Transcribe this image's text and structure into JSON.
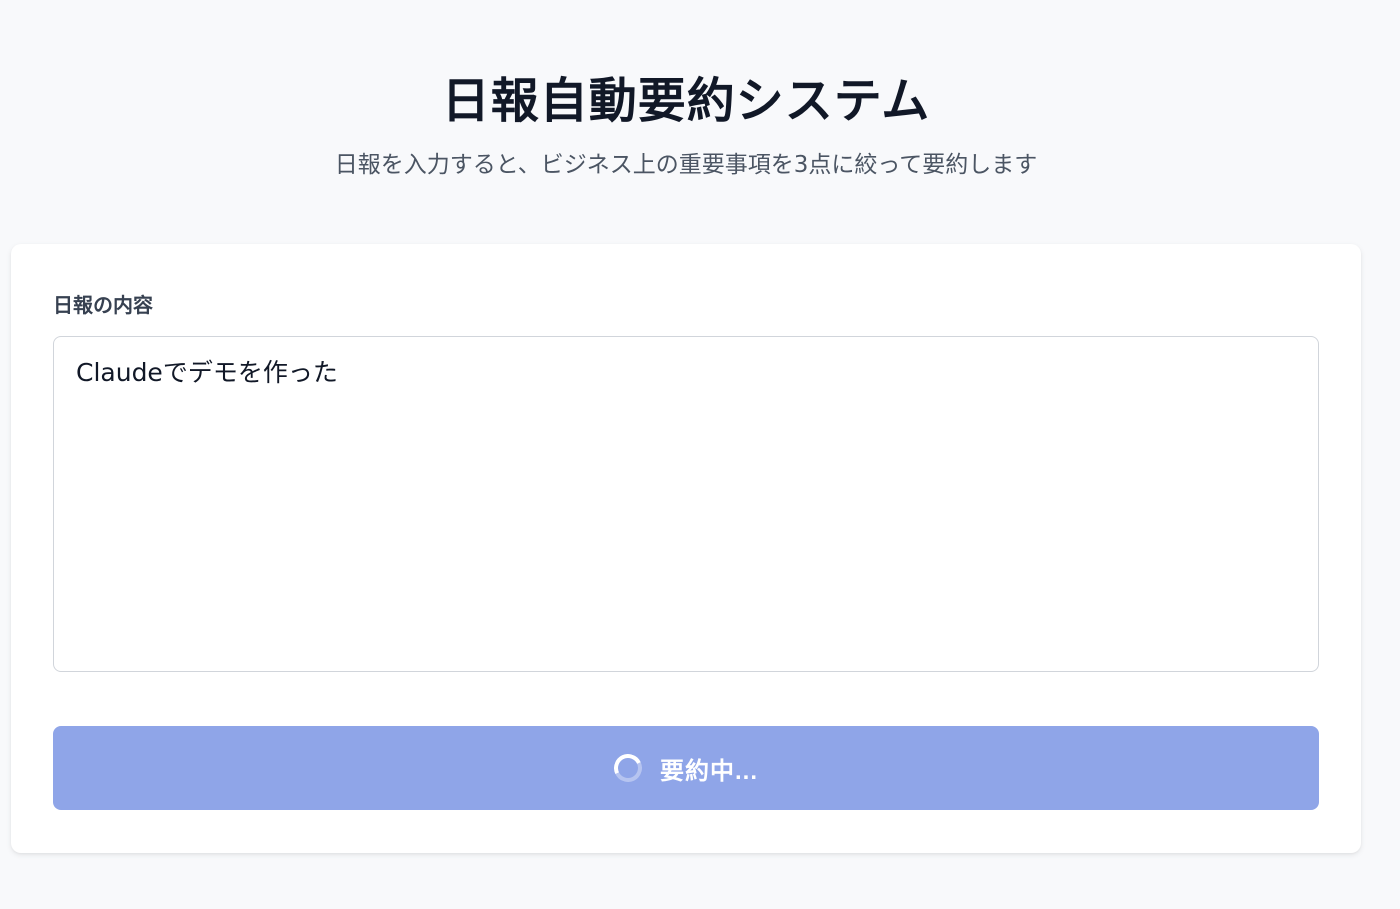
{
  "page": {
    "title": "日報自動要約システム",
    "subtitle": "日報を入力すると、ビジネス上の重要事項を3点に絞って要約します"
  },
  "form": {
    "label": "日報の内容",
    "textarea_value": "Claudeでデモを作った",
    "submit_label": "要約中...",
    "submit_state": "loading"
  },
  "colors": {
    "background": "#f8f9fb",
    "card": "#ffffff",
    "button_disabled": "#8fa5e8",
    "title_text": "#111827",
    "subtitle_text": "#4b5563"
  },
  "icons": {
    "loading": "spinner-icon"
  }
}
